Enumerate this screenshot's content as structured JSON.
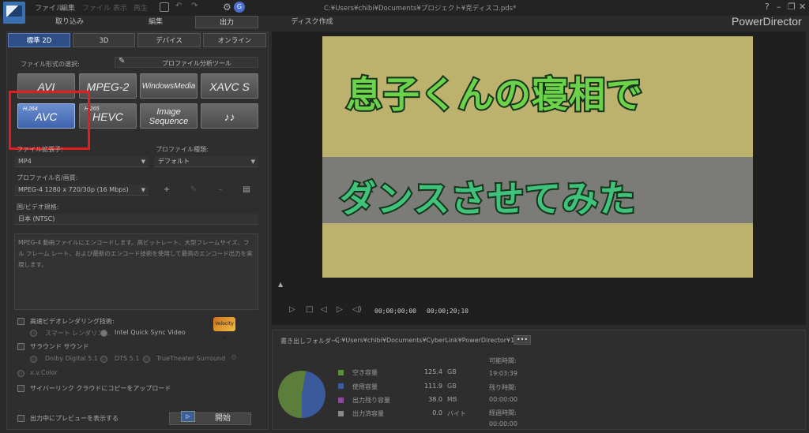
{
  "menu": {
    "file": "ファイル",
    "edit": "編集",
    "file2": "ファイル",
    "view": "表示",
    "play": "再生",
    "project_path": "C:¥Users¥chibi¥Documents¥プロジェクト¥克ディスコ.pds*"
  },
  "main_tabs": [
    "取り込み",
    "編集",
    "出力",
    "ディスク作成"
  ],
  "brand": "PowerDirector",
  "sub_tabs": [
    "標準 2D",
    "3D",
    "デバイス",
    "オンライン"
  ],
  "format_section_label": "ファイル形式の選択:",
  "analysis_tool": "プロファイル分析ツール",
  "formats": [
    {
      "label": "AVI",
      "sup": ""
    },
    {
      "label": "MPEG-2",
      "sup": ""
    },
    {
      "label": "WindowsMedia",
      "sup": ""
    },
    {
      "label": "XAVC S",
      "sup": ""
    },
    {
      "label": "AVC",
      "sup": "H.264"
    },
    {
      "label": "HEVC",
      "sup": "H.265"
    },
    {
      "label": "Image Sequence",
      "sup": ""
    },
    {
      "label": "♪♪",
      "sup": ""
    }
  ],
  "extension": {
    "label": "ファイル拡張子:",
    "value": "MP4"
  },
  "profile_type": {
    "label": "プロファイル種類:",
    "value": "デフォルト"
  },
  "profile_name": {
    "label": "プロファイル名/画質:",
    "value": "MPEG-4 1280 x 720/30p (16 Mbps)"
  },
  "region": {
    "label": "国/ビデオ規格:",
    "value": "日本 (NTSC)"
  },
  "description": "MPEG-4 動画ファイルにエンコードします。高ビットレート、大型フレームサイズ、フル フレーム レート、および最新のエンコード技術を使用して最高のエンコード出力を実現します。",
  "options": {
    "fast_render": "高速ビデオレンダリング技術:",
    "smart_render": "スマート レンダリン...",
    "intel_qsv": "Intel Quick Sync Video",
    "velocity": "Velocity 8",
    "surround": "サラウンド サウンド",
    "dolby": "Dolby Digital 5.1",
    "dts": "DTS 5.1",
    "truetheater": "TrueTheater Surround",
    "xvcolor": "x.v.Color",
    "cyberlink_cloud": "サイバーリンク クラウドにコピーをアップロード",
    "preview_while_output": "出力中にプレビューを表示する"
  },
  "start_button": "開始",
  "preview": {
    "line1": "息子くんの寝相で",
    "line2": "ダンスさせてみた",
    "timecode_current": "00;00;00;00",
    "timecode_total": "00;00;20;10"
  },
  "output": {
    "folder_label": "書き出しフォルダー:",
    "folder_path": "C:¥Users¥chibi¥Documents¥CyberLink¥PowerDirector¥1",
    "more": "•••",
    "stats": [
      {
        "label": "空き容量",
        "value": "125.4",
        "unit": "GB",
        "color": "#5b8f3b"
      },
      {
        "label": "使用容量",
        "value": "111.9",
        "unit": "GB",
        "color": "#3a5a9c"
      },
      {
        "label": "出力残り容量",
        "value": "38.0",
        "unit": "MB",
        "color": "#8a4aa0"
      },
      {
        "label": "出力済容量",
        "value": "0.0",
        "unit": "バイト",
        "color": "#8a8a8a"
      }
    ],
    "available_time_label": "可能時間:",
    "available_time": "19:03:39",
    "remaining_label": "残り時間:",
    "remaining": "00:00:00",
    "elapsed_label": "経過時間:",
    "elapsed": "00:00:00"
  },
  "chart_data": {
    "type": "pie",
    "slices": [
      {
        "name": "空き容量",
        "value": 125.4
      },
      {
        "name": "使用容量",
        "value": 111.9
      }
    ]
  },
  "colors": {
    "accent": "#2d4f86",
    "selected_format": "#4f73bd",
    "highlight_box": "#e41e1e"
  }
}
